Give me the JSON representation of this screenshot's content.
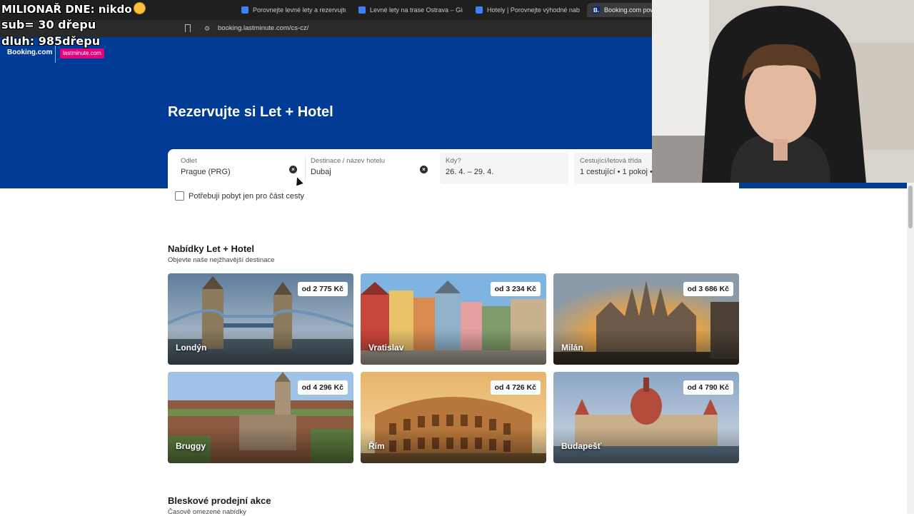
{
  "browser": {
    "tabs": [
      {
        "label": "Porovnejte levné lety a rezervujte si l"
      },
      {
        "label": "Levné lety na trase Ostrava – Girona"
      },
      {
        "label": "Hotely | Porovnejte výhodné nabídky"
      },
      {
        "label": "Booking.com powe",
        "favicon": "B.",
        "active": true
      }
    ],
    "url": "booking.lastminute.com/cs-cz/"
  },
  "header": {
    "brand": "Booking.com",
    "partner": "lastminute.com",
    "title": "Rezervujte si Let + Hotel"
  },
  "search": {
    "origin": {
      "label": "Odlet",
      "value": "Prague (PRG)"
    },
    "destination": {
      "label": "Destinace / název hotelu",
      "value": "Dubaj"
    },
    "dates": {
      "label": "Kdy?",
      "value": "26. 4. – 29. 4."
    },
    "travellers": {
      "label": "Cestující/letová třída",
      "value": "1 cestující • 1 pokoj •"
    },
    "partial_stay_label": "Potřebuji pobyt jen pro část cesty",
    "partial_stay_checked": false
  },
  "offers": {
    "title": "Nabídky Let + Hotel",
    "subtitle": "Objevte naše nejžhavější destinace",
    "cards": [
      {
        "city": "Londýn",
        "price": "od 2 775 Kč"
      },
      {
        "city": "Vratislav",
        "price": "od 3 234 Kč"
      },
      {
        "city": "Milán",
        "price": "od 3 686 Kč"
      },
      {
        "city": "Bruggy",
        "price": "od 4 296 Kč"
      },
      {
        "city": "Řím",
        "price": "od 4 726 Kč"
      },
      {
        "city": "Budapešť",
        "price": "od 4 790 Kč"
      }
    ]
  },
  "flash_sales": {
    "title": "Bleskové prodejní akce",
    "subtitle": "Časově omezené nabídky"
  },
  "overlay": {
    "line1": "MILIONAŘ DNE: nikdo",
    "line2": "sub= 30 dřepu",
    "line3": "dluh: 985dřepu"
  },
  "colors": {
    "brand_blue": "#003b95",
    "partner_pink": "#e5007d"
  }
}
